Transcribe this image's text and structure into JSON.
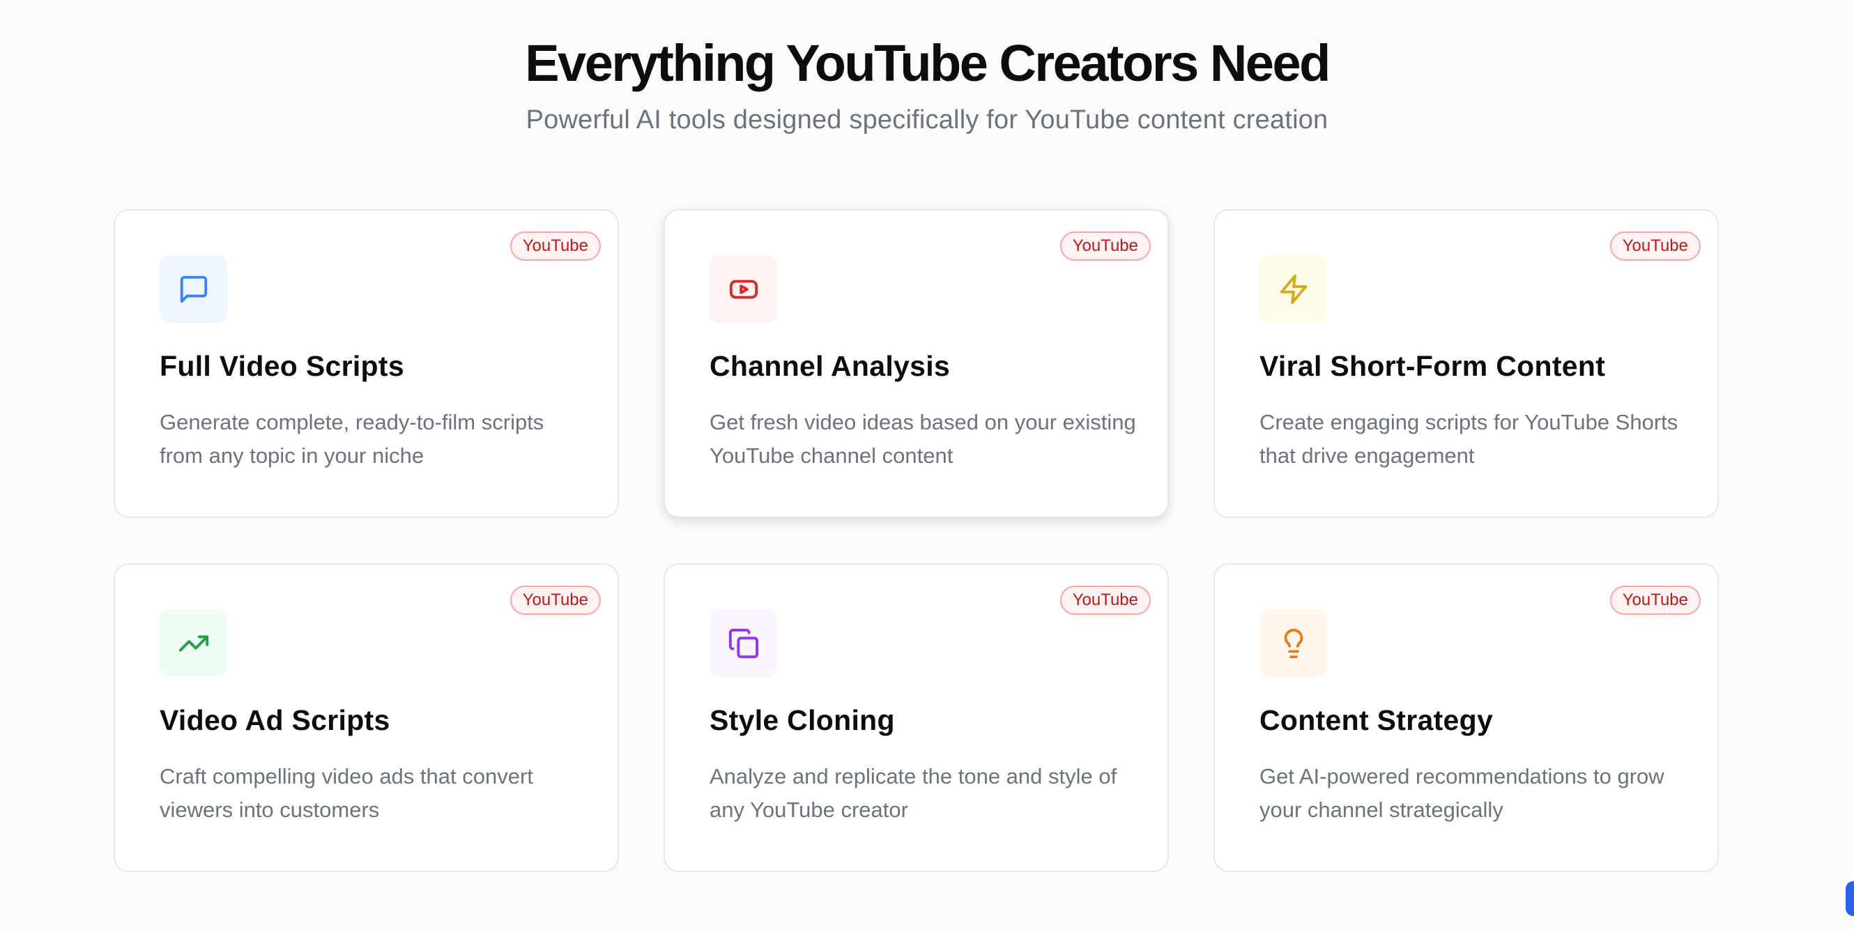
{
  "section": {
    "title": "Everything YouTube Creators Need",
    "subtitle": "Powerful AI tools designed specifically for YouTube content creation"
  },
  "cards": [
    {
      "badge": "YouTube",
      "icon": "message-square-icon",
      "title": "Full Video Scripts",
      "description": "Generate complete, ready-to-film scripts from any topic in your niche",
      "icon_color": "#3b82f6",
      "icon_bg": "#eff6ff"
    },
    {
      "badge": "YouTube",
      "icon": "youtube-icon",
      "title": "Channel Analysis",
      "description": "Get fresh video ideas based on your existing YouTube channel content",
      "icon_color": "#dc2626",
      "icon_bg": "#fef2f2"
    },
    {
      "badge": "YouTube",
      "icon": "lightning-bolt-icon",
      "title": "Viral Short-Form Content",
      "description": "Create engaging scripts for YouTube Shorts that drive engagement",
      "icon_color": "#d4a91a",
      "icon_bg": "#fefce8"
    },
    {
      "badge": "YouTube",
      "icon": "trending-up-icon",
      "title": "Video Ad Scripts",
      "description": "Craft compelling video ads that convert viewers into customers",
      "icon_color": "#22a04b",
      "icon_bg": "#f0fdf4"
    },
    {
      "badge": "YouTube",
      "icon": "copy-icon",
      "title": "Style Cloning",
      "description": "Analyze and replicate the tone and style of any YouTube creator",
      "icon_color": "#9333ea",
      "icon_bg": "#faf5ff"
    },
    {
      "badge": "YouTube",
      "icon": "lightbulb-icon",
      "title": "Content Strategy",
      "description": "Get AI-powered recommendations to grow your channel strategically",
      "icon_color": "#ea7a16",
      "icon_bg": "#fff7ed"
    }
  ]
}
